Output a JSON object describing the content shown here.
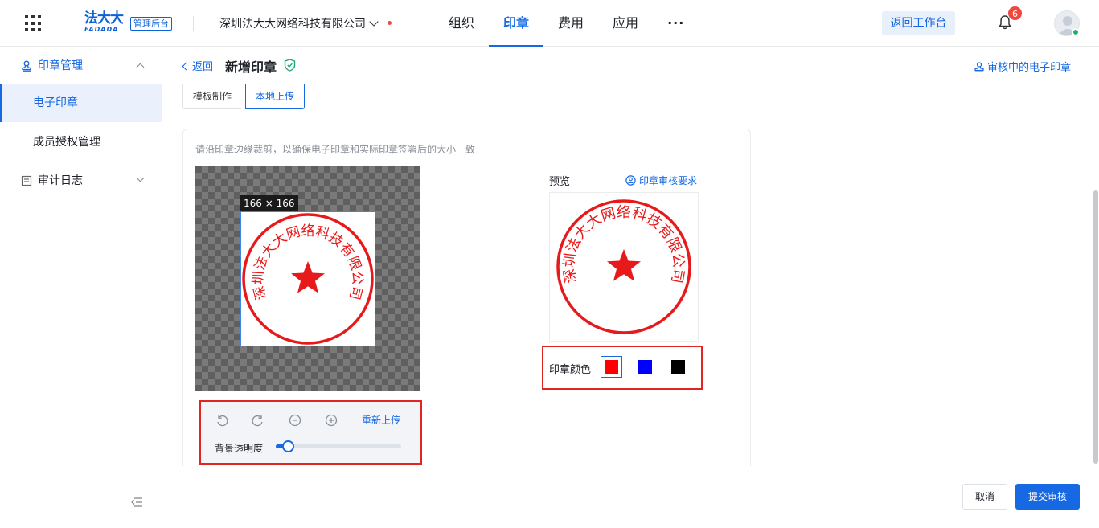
{
  "topbar": {
    "logo_cn": "法大大",
    "logo_en": "FADADA",
    "admin_badge": "管理后台",
    "company": "深圳法大大网络科技有限公司",
    "nav": [
      "组织",
      "印章",
      "费用",
      "应用",
      "···"
    ],
    "nav_active_index": 1,
    "back_workbench": "返回工作台",
    "notification_count": "6"
  },
  "sidebar": {
    "groups": [
      {
        "label": "印章管理",
        "icon": "stamp-icon",
        "expanded": true
      },
      {
        "label": "审计日志",
        "icon": "log-icon",
        "expanded": false
      }
    ],
    "items": [
      {
        "label": "电子印章",
        "active": true
      },
      {
        "label": "成员授权管理",
        "active": false
      }
    ]
  },
  "header": {
    "back": "返回",
    "title": "新增印章",
    "reviewing_link": "审核中的电子印章"
  },
  "tabs": [
    {
      "label": "模板制作",
      "active": false
    },
    {
      "label": "本地上传",
      "active": true
    }
  ],
  "upload": {
    "tip": "请沿印章边缘裁剪，以确保电子印章和实际印章签署后的大小一致",
    "crop_size": "166 × 166",
    "stamp_text": "深圳法大大网络科技有限公司",
    "tools": [
      "rotate-left-icon",
      "rotate-right-icon",
      "zoom-out-icon",
      "zoom-in-icon"
    ],
    "reupload": "重新上传",
    "opacity_label": "背景透明度",
    "opacity_fraction": 0.1
  },
  "preview": {
    "label": "预览",
    "review_req": "印章审核要求",
    "color_label": "印章颜色",
    "colors": [
      "#ff0000",
      "#0000ff",
      "#000000"
    ],
    "selected_color_index": 0
  },
  "footer": {
    "cancel": "取消",
    "submit": "提交审核"
  }
}
